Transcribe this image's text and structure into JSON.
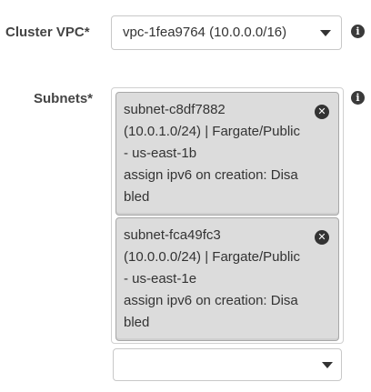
{
  "vpc": {
    "label": "Cluster VPC*",
    "selected_value": "vpc-1fea9764 (10.0.0.0/16)",
    "info_icon": "info-icon",
    "caret_icon": "caret-down-icon"
  },
  "subnets": {
    "label": "Subnets*",
    "info_icon": "info-icon",
    "remove_icon": "close-circle-icon",
    "tags": [
      {
        "lines": [
          "subnet-c8df7882",
          "(10.0.1.0/24) | Fargate/Public",
          "- us-east-1b",
          "assign ipv6 on creation: Disa",
          "bled"
        ]
      },
      {
        "lines": [
          "subnet-fca49fc3",
          "(10.0.0.0/24) | Fargate/Public",
          "- us-east-1e",
          "assign ipv6 on creation: Disa",
          "bled"
        ]
      }
    ],
    "add_select_value": "",
    "caret_icon": "caret-down-icon"
  },
  "colors": {
    "tag_background": "#dcdcdc",
    "tag_border": "#a8a8a8",
    "icon_dark": "#333333"
  }
}
